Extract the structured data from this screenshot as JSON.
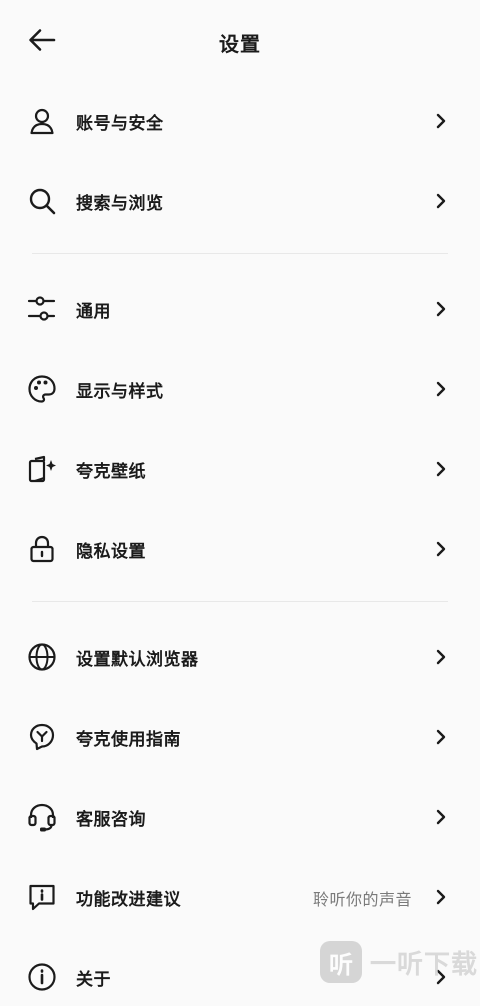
{
  "header": {
    "title": "设置",
    "back_icon": "arrow-left-icon"
  },
  "groups": [
    {
      "items": [
        {
          "label": "账号与安全",
          "icon": "user-icon"
        },
        {
          "label": "搜索与浏览",
          "icon": "search-icon"
        }
      ]
    },
    {
      "items": [
        {
          "label": "通用",
          "icon": "sliders-icon"
        },
        {
          "label": "显示与样式",
          "icon": "palette-icon"
        },
        {
          "label": "夸克壁纸",
          "icon": "wallpaper-sparkle-icon"
        },
        {
          "label": "隐私设置",
          "icon": "lock-icon"
        }
      ]
    },
    {
      "items": [
        {
          "label": "设置默认浏览器",
          "icon": "globe-icon"
        },
        {
          "label": "夸克使用指南",
          "icon": "bulb-guide-icon"
        },
        {
          "label": "客服咨询",
          "icon": "headset-icon"
        },
        {
          "label": "功能改进建议",
          "icon": "feedback-icon",
          "value": "聆听你的声音"
        },
        {
          "label": "关于",
          "icon": "info-icon"
        }
      ]
    }
  ],
  "watermark": {
    "badge": "听",
    "text": "一听下载"
  }
}
